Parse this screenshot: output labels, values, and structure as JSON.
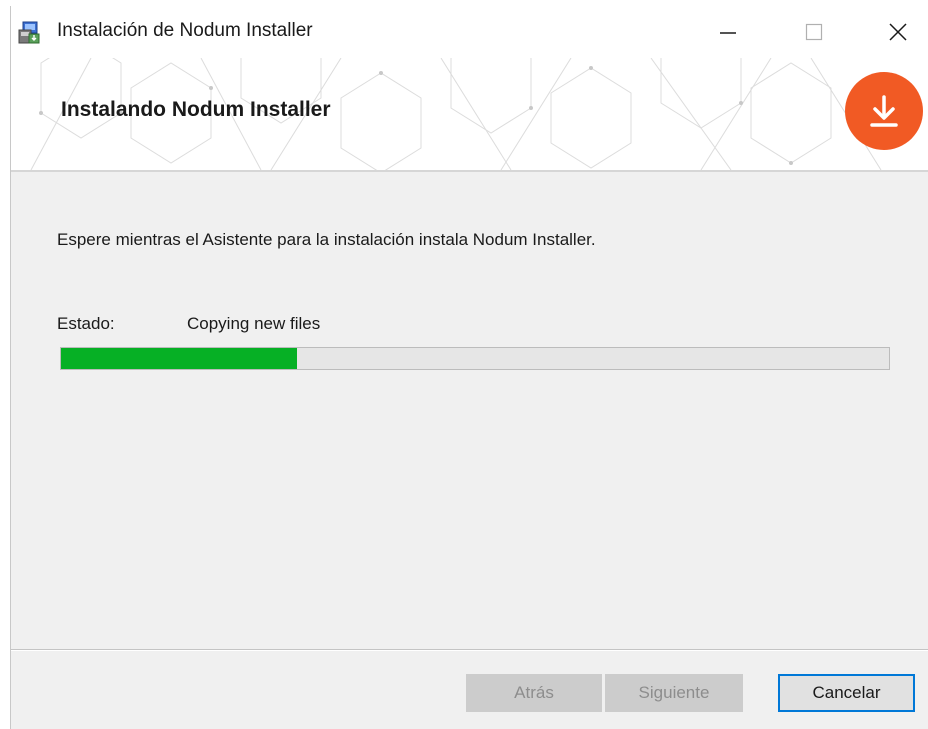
{
  "window": {
    "title": "Instalación de Nodum Installer",
    "controls": {
      "minimize_icon": "minimize-icon",
      "maximize_icon": "maximize-icon",
      "close_icon": "close-icon"
    }
  },
  "header": {
    "title": "Instalando Nodum Installer",
    "logo_icon": "download-arrow-icon",
    "logo_color": "#f15a24"
  },
  "main": {
    "message": "Espere mientras el Asistente para la instalación instala Nodum Installer.",
    "status_label": "Estado:",
    "status_value": "Copying new files",
    "progress_fraction": 0.285,
    "progress_color": "#06b025"
  },
  "footer": {
    "back_label": "Atrás",
    "next_label": "Siguiente",
    "cancel_label": "Cancelar"
  }
}
